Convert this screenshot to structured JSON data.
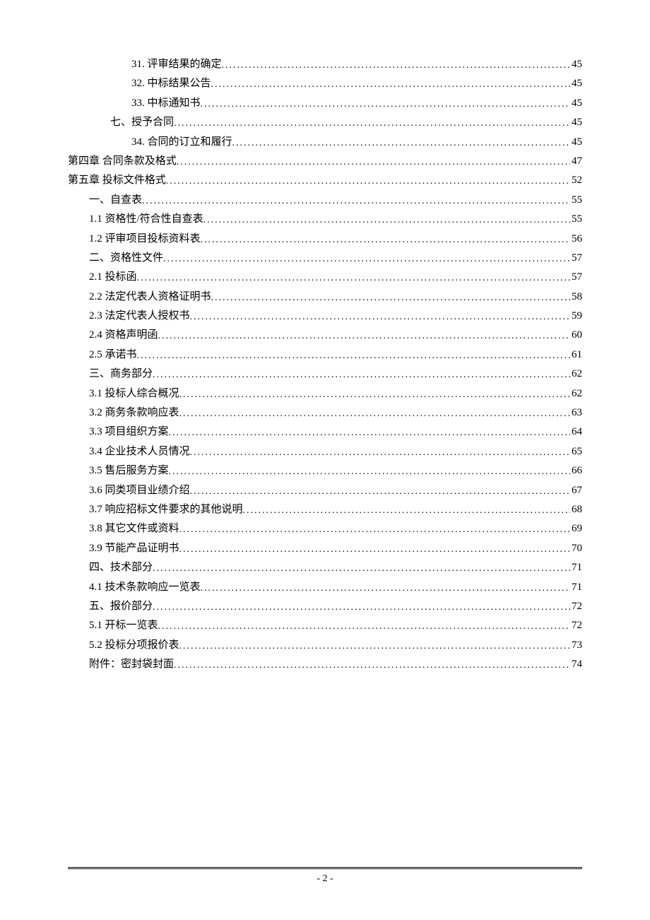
{
  "toc": [
    {
      "indent": "ind3",
      "label": "31. 评审结果的确定",
      "page": "45"
    },
    {
      "indent": "ind3",
      "label": "32. 中标结果公告",
      "page": "45"
    },
    {
      "indent": "ind3",
      "label": "33. 中标通知书",
      "page": "45"
    },
    {
      "indent": "ind2",
      "label": "七、授予合同",
      "page": "45"
    },
    {
      "indent": "ind3",
      "label": "34. 合同的订立和履行",
      "page": "45"
    },
    {
      "indent": "",
      "label": "第四章   合同条款及格式",
      "page": "47"
    },
    {
      "indent": "",
      "label": "第五章   投标文件格式",
      "page": "52"
    },
    {
      "indent": "ind1",
      "label": "一、自查表",
      "page": "55"
    },
    {
      "indent": "ind1",
      "label": "1.1 资格性/符合性自查表",
      "page": "55"
    },
    {
      "indent": "ind1",
      "label": "1.2 评审项目投标资料表",
      "page": "56"
    },
    {
      "indent": "ind1",
      "label": "二、资格性文件",
      "page": "57"
    },
    {
      "indent": "ind1",
      "label": "2.1 投标函",
      "page": "57"
    },
    {
      "indent": "ind1",
      "label": "2.2 法定代表人资格证明书",
      "page": "58"
    },
    {
      "indent": "ind1",
      "label": "2.3 法定代表人授权书",
      "page": "59"
    },
    {
      "indent": "ind1",
      "label": "2.4 资格声明函",
      "page": "60"
    },
    {
      "indent": "ind1",
      "label": "2.5 承诺书",
      "page": "61"
    },
    {
      "indent": "ind1",
      "label": "三、商务部分",
      "page": "62"
    },
    {
      "indent": "ind1",
      "label": "3.1 投标人综合概况",
      "page": "62"
    },
    {
      "indent": "ind1",
      "label": "3.2 商务条款响应表",
      "page": "63"
    },
    {
      "indent": "ind1",
      "label": "3.3 项目组织方案",
      "page": "64"
    },
    {
      "indent": "ind1",
      "label": "3.4 企业技术人员情况",
      "page": "65"
    },
    {
      "indent": "ind1",
      "label": "3.5 售后服务方案",
      "page": "66"
    },
    {
      "indent": "ind1",
      "label": "3.6 同类项目业绩介绍",
      "page": "67"
    },
    {
      "indent": "ind1",
      "label": "3.7 响应招标文件要求的其他说明",
      "page": "68"
    },
    {
      "indent": "ind1",
      "label": "3.8 其它文件或资料",
      "page": "69"
    },
    {
      "indent": "ind1",
      "label": "3.9 节能产品证明书",
      "page": "70"
    },
    {
      "indent": "ind1",
      "label": "四、技术部分",
      "page": "71"
    },
    {
      "indent": "ind1",
      "label": "4.1 技术条款响应一览表",
      "page": "71"
    },
    {
      "indent": "ind1",
      "label": "五、报价部分",
      "page": "72"
    },
    {
      "indent": "ind1",
      "label": "5.1 开标一览表",
      "page": "72"
    },
    {
      "indent": "ind1",
      "label": "5.2 投标分项报价表",
      "page": "73"
    },
    {
      "indent": "ind1",
      "label": "附件：密封袋封面",
      "page": "74"
    }
  ],
  "footer": {
    "page_label": "- 2 -"
  }
}
